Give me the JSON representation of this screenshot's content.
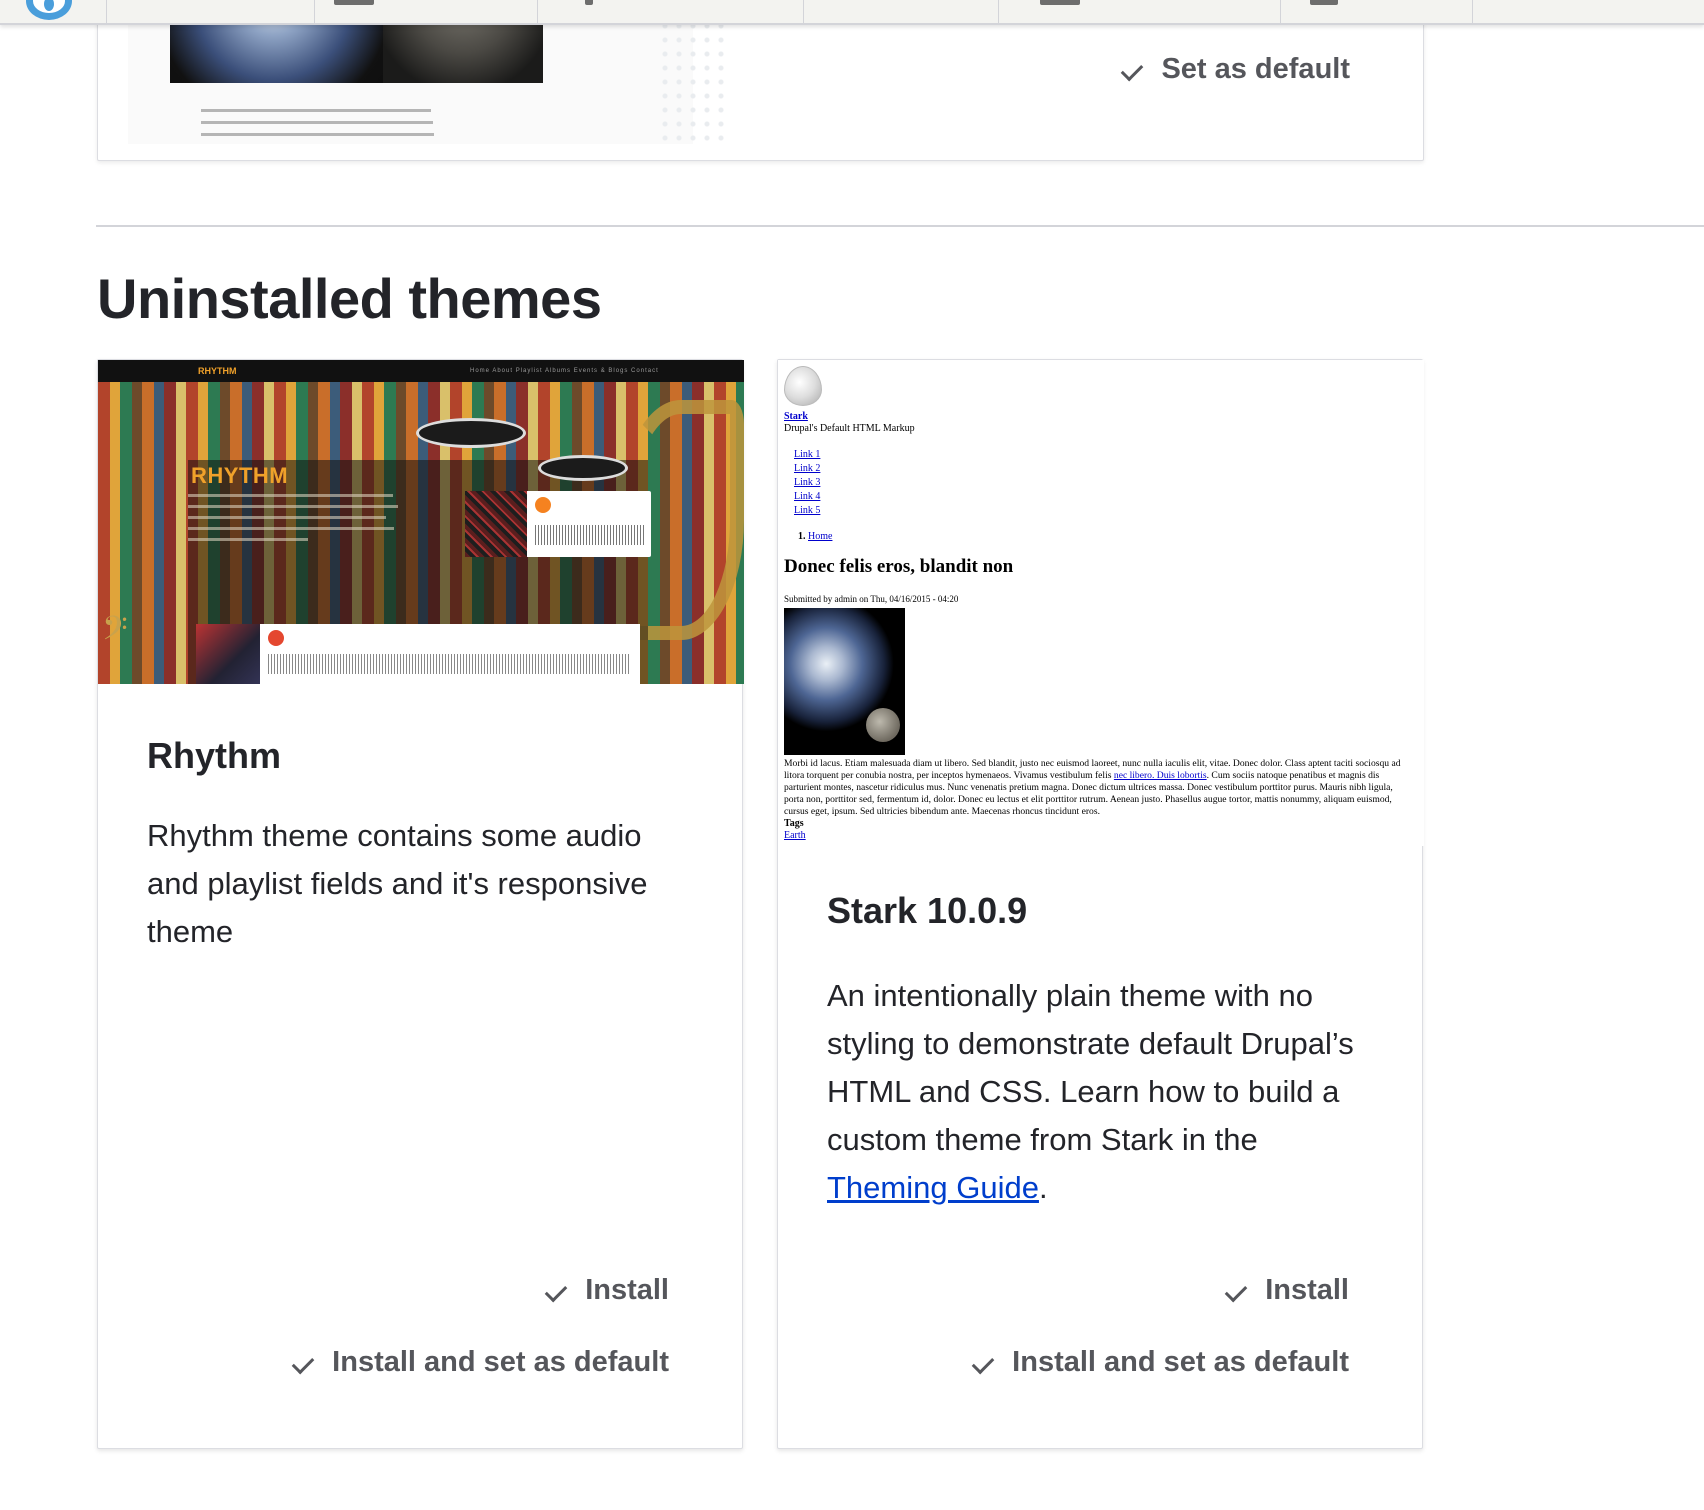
{
  "installed": {
    "set_default_label": "Set as default",
    "preview_text_1": "Morbi id lacus. Etiam malesuada diam ut libero. ",
    "preview_link_1": "Sed blandit",
    "preview_text_2": ", justo nec euismod laoreet, nunc nulla iaculis elit, vitae. Taciti sociosqu ad litora torquent per conubia nostra, per inceptos hymenaeos. Vivamus vestibulum felis ",
    "preview_link_2": "nec libero. Duis lobortis"
  },
  "section": {
    "title": "Uninstalled themes"
  },
  "themes": [
    {
      "name": "Rhythm",
      "description": "Rhythm theme contains some audio and playlist fields and it's responsive theme",
      "install_label": "Install",
      "install_default_label": "Install and set as default",
      "preview": {
        "logo": "RHYTHM",
        "nav": "Home   About   Playlist   Albums   Events & Blogs   Contact",
        "brand": "RHYTHM"
      }
    },
    {
      "name": "Stark 10.0.9",
      "description_prefix": "An intentionally plain theme with no styling to demonstrate default Drupal’s HTML and CSS. Learn how to build a custom theme from Stark in the ",
      "description_link": "Theming Guide",
      "description_suffix": ".",
      "install_label": "Install",
      "install_default_label": "Install and set as default",
      "preview": {
        "site_name": "Stark",
        "slogan": "Drupal's Default HTML Markup",
        "links": [
          "Link 1",
          "Link 2",
          "Link 3",
          "Link 4",
          "Link 5"
        ],
        "breadcrumb_num": "1.",
        "breadcrumb": "Home",
        "node_title": "Donec felis eros, blandit non",
        "submitted": "Submitted by admin on Thu, 04/16/2015 - 04:20",
        "body_1": "Morbi id lacus. Etiam malesuada diam ut libero. Sed blandit, justo nec euismod laoreet, nunc nulla iaculis elit, vitae. Donec dolor. Class aptent taciti sociosqu ad litora torquent per conubia nostra, per inceptos hymenaeos. Vivamus vestibulum felis ",
        "body_link": "nec libero. Duis lobortis",
        "body_2": ". Cum sociis natoque penatibus et magnis dis parturient montes, nascetur ridiculus mus. Nunc venenatis pretium magna. Donec dictum ultrices massa. Donec vestibulum porttitor purus. Mauris nibh ligula, porta non, porttitor sed, fermentum id, dolor. Donec eu lectus et elit porttitor rutrum. Aenean justo. Phasellus augue tortor, mattis nonummy, aliquam euismod, cursus eget, ipsum. Sed ultricies bibendum ante. Maecenas rhoncus tincidunt eros.",
        "tags_label": "Tags",
        "tag": "Earth"
      }
    }
  ],
  "colors": {
    "link": "#003ecc",
    "action_text": "#55565b",
    "heading": "#232429",
    "border": "#dcdde2"
  }
}
